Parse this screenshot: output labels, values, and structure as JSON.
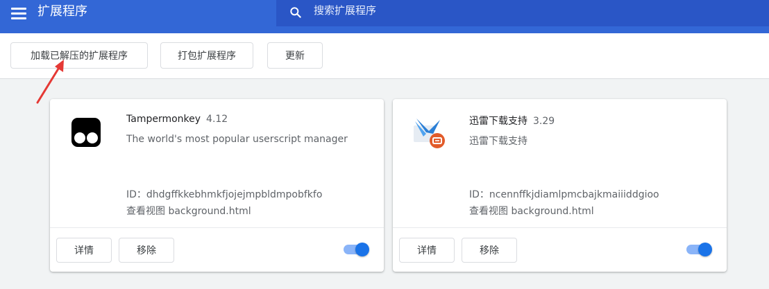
{
  "header": {
    "title": "扩展程序",
    "search_placeholder": "搜索扩展程序"
  },
  "toolbar": {
    "load_unpacked_label": "加载已解压的扩展程序",
    "pack_label": "打包扩展程序",
    "update_label": "更新"
  },
  "annotation": {
    "arrow_color": "#e53935"
  },
  "extensions": [
    {
      "name": "Tampermonkey",
      "version": "4.12",
      "description": "The world's most popular userscript manager",
      "id_text": "ID：dhdgffkkebhmkfjojejmpbldmpobfkfo",
      "view_prefix": "查看视图",
      "view_link": "background.html",
      "details_label": "详情",
      "remove_label": "移除",
      "enabled": true,
      "icon": "tampermonkey-icon"
    },
    {
      "name": "迅雷下载支持",
      "version": "3.29",
      "description": "迅雷下载支持",
      "id_text": "ID：ncennffkjdiamlpmcbajkmaiiiddgioo",
      "view_prefix": "查看视图",
      "view_link": "background.html",
      "details_label": "详情",
      "remove_label": "移除",
      "enabled": true,
      "icon": "thunder-bird-icon"
    }
  ],
  "colors": {
    "header": "#3367d6",
    "search_bg": "#2a56c6",
    "toggle_on": "#1a73e8"
  }
}
